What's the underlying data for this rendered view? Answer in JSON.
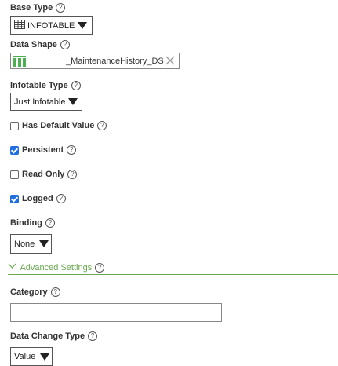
{
  "base_type": {
    "label": "Base Type",
    "value": "INFOTABLE"
  },
  "data_shape": {
    "label": "Data Shape",
    "value": "_MaintenanceHistory_DS"
  },
  "infotable_type": {
    "label": "Infotable Type",
    "value": "Just Infotable"
  },
  "has_default_value": {
    "label": "Has Default Value",
    "checked": false
  },
  "persistent": {
    "label": "Persistent",
    "checked": true
  },
  "read_only": {
    "label": "Read Only",
    "checked": false
  },
  "logged": {
    "label": "Logged",
    "checked": true
  },
  "binding": {
    "label": "Binding",
    "value": "None"
  },
  "advanced_settings": {
    "label": "Advanced Settings",
    "color": "#6aa84f"
  },
  "category": {
    "label": "Category",
    "value": ""
  },
  "data_change_type": {
    "label": "Data Change Type",
    "value": "Value"
  },
  "help_glyph": "?",
  "icons": {
    "table": "table-icon",
    "datashape": "data-shape-icon",
    "clear": "clear-icon"
  }
}
